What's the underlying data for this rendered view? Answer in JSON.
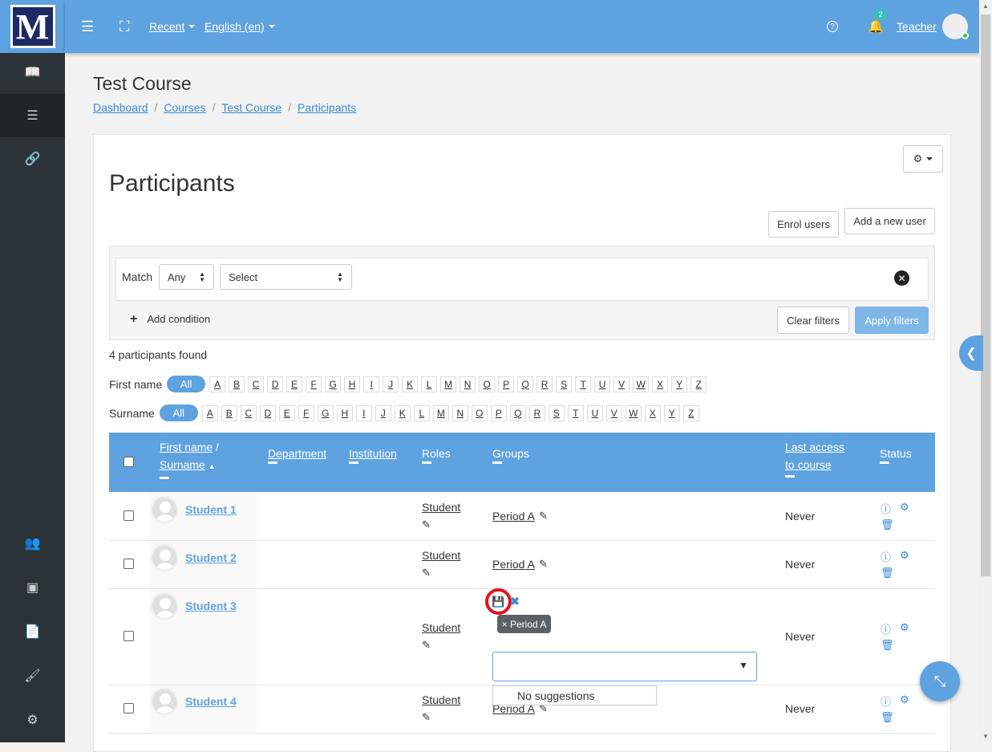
{
  "topbar": {
    "logo_letter": "M",
    "recent": "Recent",
    "language": "English (en)",
    "help": "?",
    "notification_count": "2",
    "user": "Teacher"
  },
  "sidebar": {
    "icons": [
      "book-icon",
      "list-icon",
      "link-icon",
      "users-icon",
      "archive-icon",
      "file-icon",
      "brush-icon",
      "cogs-icon"
    ]
  },
  "page": {
    "course_title": "Test Course",
    "breadcrumb": [
      "Dashboard",
      "Courses",
      "Test Course",
      "Participants"
    ],
    "heading": "Participants"
  },
  "actions": {
    "enrol": "Enrol users",
    "add_user": "Add a new user"
  },
  "filter": {
    "match_label": "Match",
    "match_value": "Any",
    "select_value": "Select",
    "add_condition": "Add condition",
    "clear": "Clear filters",
    "apply": "Apply filters"
  },
  "found": "4 participants found",
  "initials": {
    "first_label": "First name",
    "surname_label": "Surname",
    "all": "All",
    "letters": [
      "A",
      "B",
      "C",
      "D",
      "E",
      "F",
      "G",
      "H",
      "I",
      "J",
      "K",
      "L",
      "M",
      "N",
      "O",
      "P",
      "Q",
      "R",
      "S",
      "T",
      "U",
      "V",
      "W",
      "X",
      "Y",
      "Z"
    ]
  },
  "table": {
    "headers": {
      "firstname": "First name",
      "slash": "/",
      "surname": "Surname",
      "department": "Department",
      "institution": "Institution",
      "roles": "Roles",
      "groups": "Groups",
      "last_access_1": "Last access",
      "last_access_2": "to course",
      "status": "Status"
    },
    "rows": [
      {
        "name": "Student 1",
        "role": "Student",
        "group": "Period A",
        "access": "Never"
      },
      {
        "name": "Student 2",
        "role": "Student",
        "group": "Period A",
        "access": "Never"
      },
      {
        "name": "Student 3",
        "role": "Student",
        "group": "",
        "access": "Never"
      },
      {
        "name": "Student 4",
        "role": "Student",
        "group": "Period A",
        "access": "Never"
      }
    ]
  },
  "group_editor": {
    "chip": "× Period A",
    "no_suggestions": "No suggestions"
  },
  "colors": {
    "accent": "#5ea2df",
    "sidebar": "#2b3339",
    "highlight_ring": "#e0151c"
  }
}
